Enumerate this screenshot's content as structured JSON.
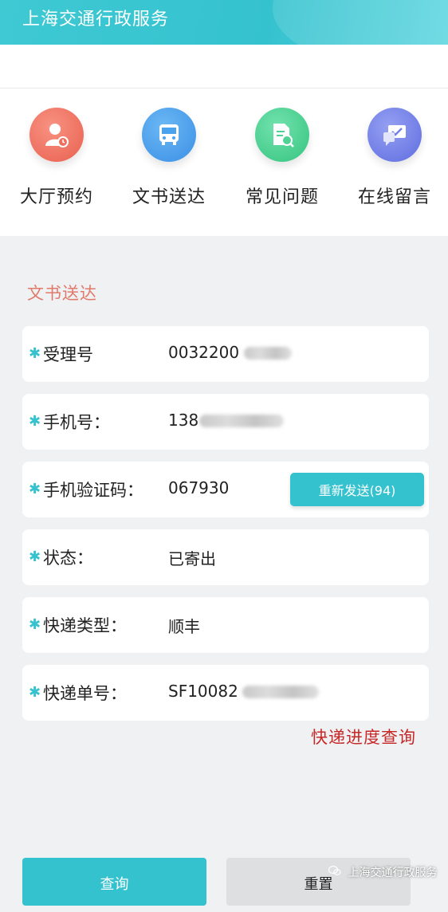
{
  "header": {
    "title": "上海交通行政服务"
  },
  "quick_nav": [
    {
      "label": "大厅预约",
      "icon": "user-clock-icon",
      "color": "#ef6f5f"
    },
    {
      "label": "文书送达",
      "icon": "bus-icon",
      "color": "#4aa3ee"
    },
    {
      "label": "常见问题",
      "icon": "document-search-icon",
      "color": "#4fd394"
    },
    {
      "label": "在线留言",
      "icon": "chat-check-icon",
      "color": "#7380e8"
    }
  ],
  "section": {
    "title": "文书送达"
  },
  "form": {
    "acceptance_no": {
      "label": "受理号",
      "value": "0032200"
    },
    "phone": {
      "label": "手机号：",
      "value": "138"
    },
    "sms_code": {
      "label": "手机验证码：",
      "value": "067930",
      "resend_label": "重新发送(94)"
    },
    "status": {
      "label": "状态：",
      "value": "已寄出"
    },
    "courier_type": {
      "label": "快递类型：",
      "value": "顺丰"
    },
    "tracking_no": {
      "label": "快递单号：",
      "value": "SF10082"
    }
  },
  "track_link": "快递进度查询",
  "buttons": {
    "query": "查询",
    "reset": "重置"
  },
  "watermark": "上海交通行政服务",
  "colors": {
    "accent": "#35c2cf",
    "section_title": "#e07a6a",
    "link": "#c62828"
  }
}
